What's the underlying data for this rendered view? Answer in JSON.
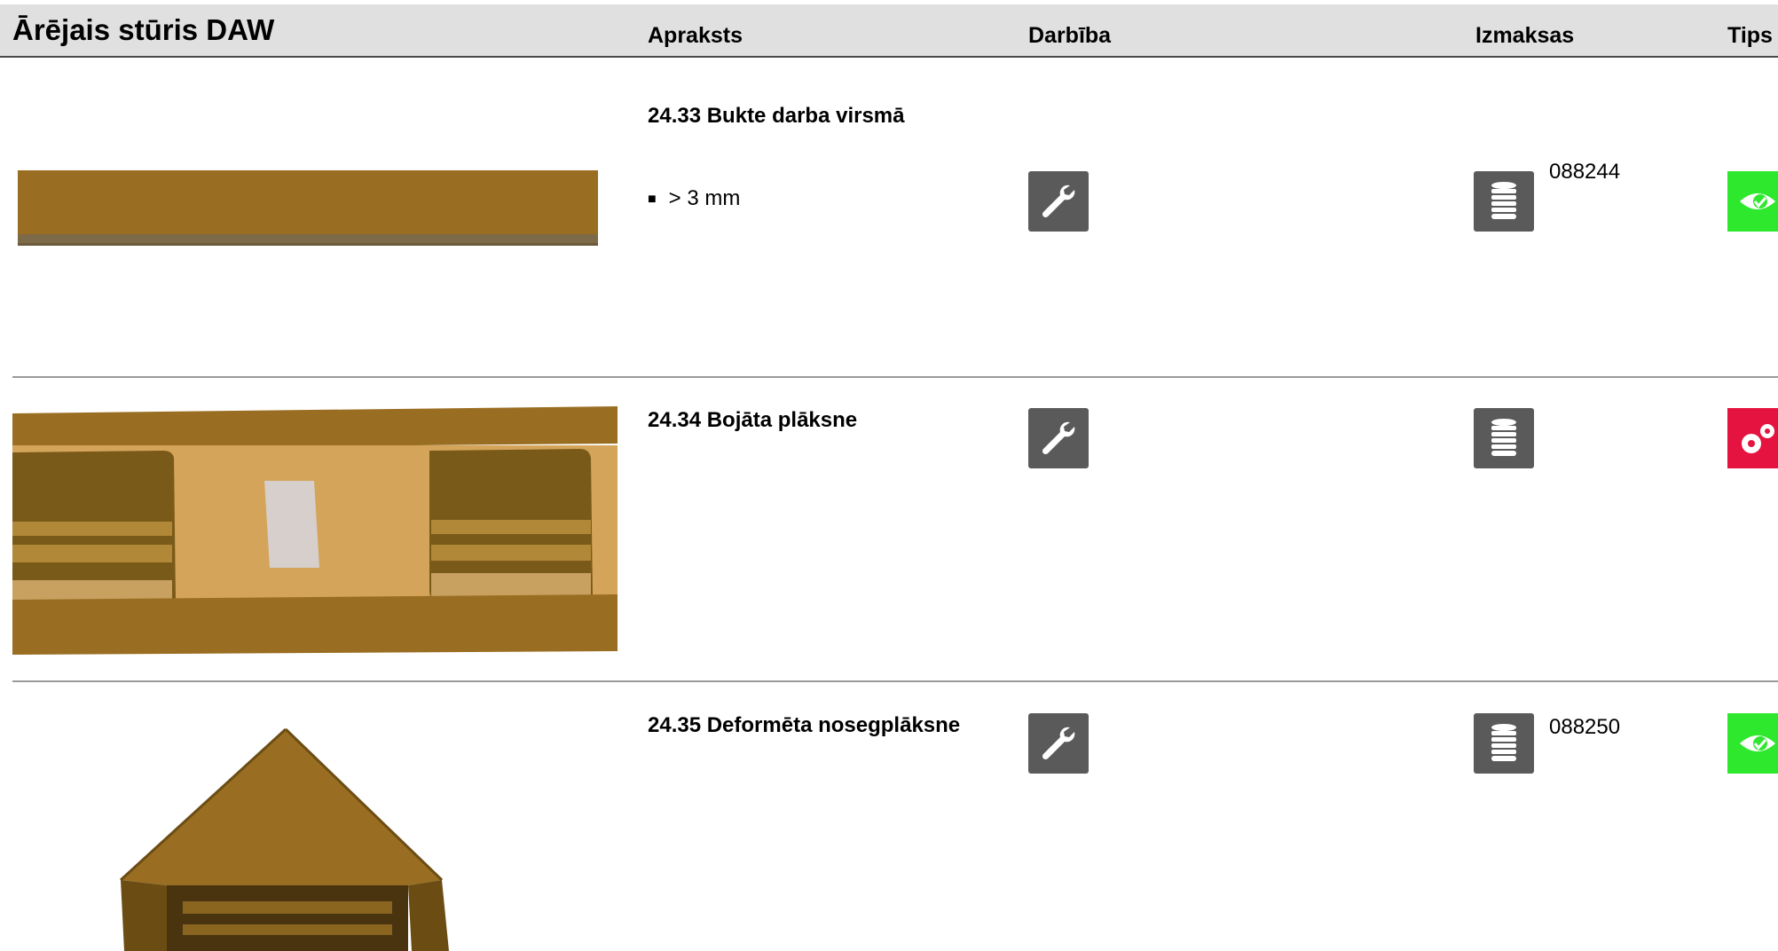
{
  "header": {
    "title": "Ārējais stūris DAW",
    "col_description": "Apraksts",
    "col_action": "Darbība",
    "col_cost": "Izmaksas",
    "col_tips": "Tips"
  },
  "rows": [
    {
      "title": "24.33 Bukte darba virsmā",
      "bullet": "> 3 mm",
      "action_icon": "wrench-icon",
      "cost_icon": "coins-icon",
      "cost_code": "088244",
      "tip_icon": "eye-icon",
      "tip_color": "#2ee82e"
    },
    {
      "title": "24.34 Bojāta plāksne",
      "action_icon": "wrench-icon",
      "cost_icon": "coins-icon",
      "cost_code": "",
      "tip_icon": "gears-icon",
      "tip_color": "#e5133f"
    },
    {
      "title": "24.35 Deformēta nosegplāksne",
      "action_icon": "wrench-icon",
      "cost_icon": "coins-icon",
      "cost_code": "088250",
      "tip_icon": "eye-icon",
      "tip_color": "#2ee82e"
    }
  ],
  "colors": {
    "header_bg": "#e0e0e0",
    "icon_bg": "#5a5a5a",
    "wood": "#9a6e22"
  }
}
